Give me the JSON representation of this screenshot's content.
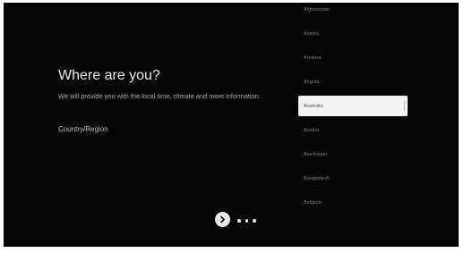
{
  "setup": {
    "title": "Where are you?",
    "description": "We will provide you with the local time, climate and more information.",
    "field_label": "Country/Region"
  },
  "countries": [
    {
      "name": "Afghanistan",
      "selected": false
    },
    {
      "name": "Algeria",
      "selected": false
    },
    {
      "name": "Andorra",
      "selected": false
    },
    {
      "name": "Angola",
      "selected": false
    },
    {
      "name": "Australia",
      "selected": true
    },
    {
      "name": "Austria",
      "selected": false
    },
    {
      "name": "Azerbaijan",
      "selected": false
    },
    {
      "name": "Bangladesh",
      "selected": false
    },
    {
      "name": "Belgium",
      "selected": false
    }
  ],
  "navigation": {
    "next_icon": "chevron-right-icon",
    "more_icon": "more-horizontal-icon"
  },
  "colors": {
    "background": "#050505",
    "selected_background": "#f3f3f3"
  }
}
